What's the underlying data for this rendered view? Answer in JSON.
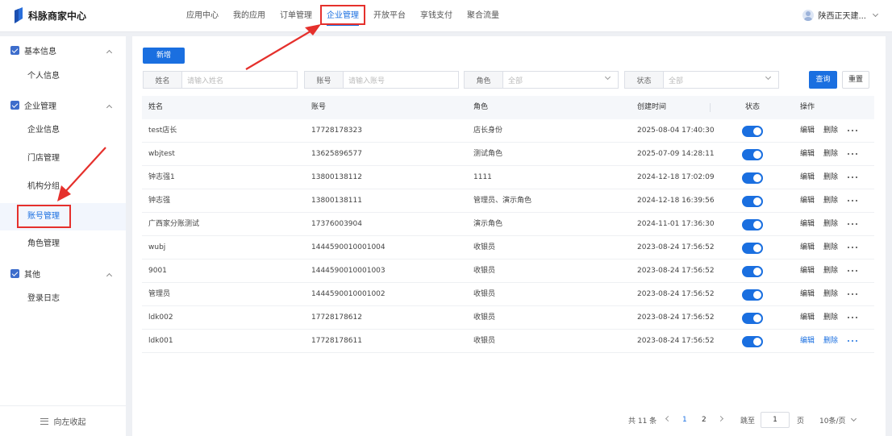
{
  "header": {
    "brand": "科脉商家中心",
    "nav": [
      "应用中心",
      "我的应用",
      "订单管理",
      "企业管理",
      "开放平台",
      "享钱支付",
      "聚合流量"
    ],
    "active_nav": "企业管理",
    "user_name": "陕西正天建..."
  },
  "sidebar": {
    "groups": [
      {
        "label": "基本信息",
        "items": [
          "个人信息"
        ]
      },
      {
        "label": "企业管理",
        "items": [
          "企业信息",
          "门店管理",
          "机构分组",
          "账号管理",
          "角色管理"
        ]
      },
      {
        "label": "其他",
        "items": [
          "登录日志"
        ]
      }
    ],
    "active_item": "账号管理",
    "collapse_label": "向左收起"
  },
  "toolbar": {
    "add_label": "新增",
    "query_label": "查询",
    "reset_label": "重置"
  },
  "filters": {
    "name_label": "姓名",
    "name_placeholder": "请输入姓名",
    "account_label": "账号",
    "account_placeholder": "请输入账号",
    "role_label": "角色",
    "role_value": "全部",
    "status_label": "状态",
    "status_value": "全部"
  },
  "table": {
    "columns": [
      "姓名",
      "账号",
      "角色",
      "创建时间",
      "状态",
      "操作"
    ],
    "rows": [
      {
        "name": "test店长",
        "account": "17728178323",
        "role": "店长身份",
        "created": "2025-08-04 17:40:30",
        "enabled": true
      },
      {
        "name": "wbjtest",
        "account": "13625896577",
        "role": "测试角色",
        "created": "2025-07-09 14:28:11",
        "enabled": true
      },
      {
        "name": "钟志强1",
        "account": "13800138112",
        "role": "1111",
        "created": "2024-12-18 17:02:09",
        "enabled": true
      },
      {
        "name": "钟志强",
        "account": "13800138111",
        "role": "管理员、演示角色",
        "created": "2024-12-18 16:39:56",
        "enabled": true
      },
      {
        "name": "广西家分账测试",
        "account": "17376003904",
        "role": "演示角色",
        "created": "2024-11-01 17:36:30",
        "enabled": true
      },
      {
        "name": "wubj",
        "account": "1444590010001004",
        "role": "收银员",
        "created": "2023-08-24 17:56:52",
        "enabled": true
      },
      {
        "name": "9001",
        "account": "1444590010001003",
        "role": "收银员",
        "created": "2023-08-24 17:56:52",
        "enabled": true
      },
      {
        "name": "管理员",
        "account": "1444590010001002",
        "role": "收银员",
        "created": "2023-08-24 17:56:52",
        "enabled": true
      },
      {
        "name": "ldk002",
        "account": "17728178612",
        "role": "收银员",
        "created": "2023-08-24 17:56:52",
        "enabled": true
      },
      {
        "name": "ldk001",
        "account": "17728178611",
        "role": "收银员",
        "created": "2023-08-24 17:56:52",
        "enabled": true
      }
    ],
    "edit_label": "编辑",
    "delete_label": "删除"
  },
  "pagination": {
    "total_text": "共 11 条",
    "pages": [
      "1",
      "2"
    ],
    "current_page": "1",
    "jump_label": "跳至",
    "jump_value": "1",
    "page_unit": "页",
    "page_size": "10条/页"
  },
  "colors": {
    "accent": "#1a6fe0",
    "annotation": "#e5302c"
  }
}
